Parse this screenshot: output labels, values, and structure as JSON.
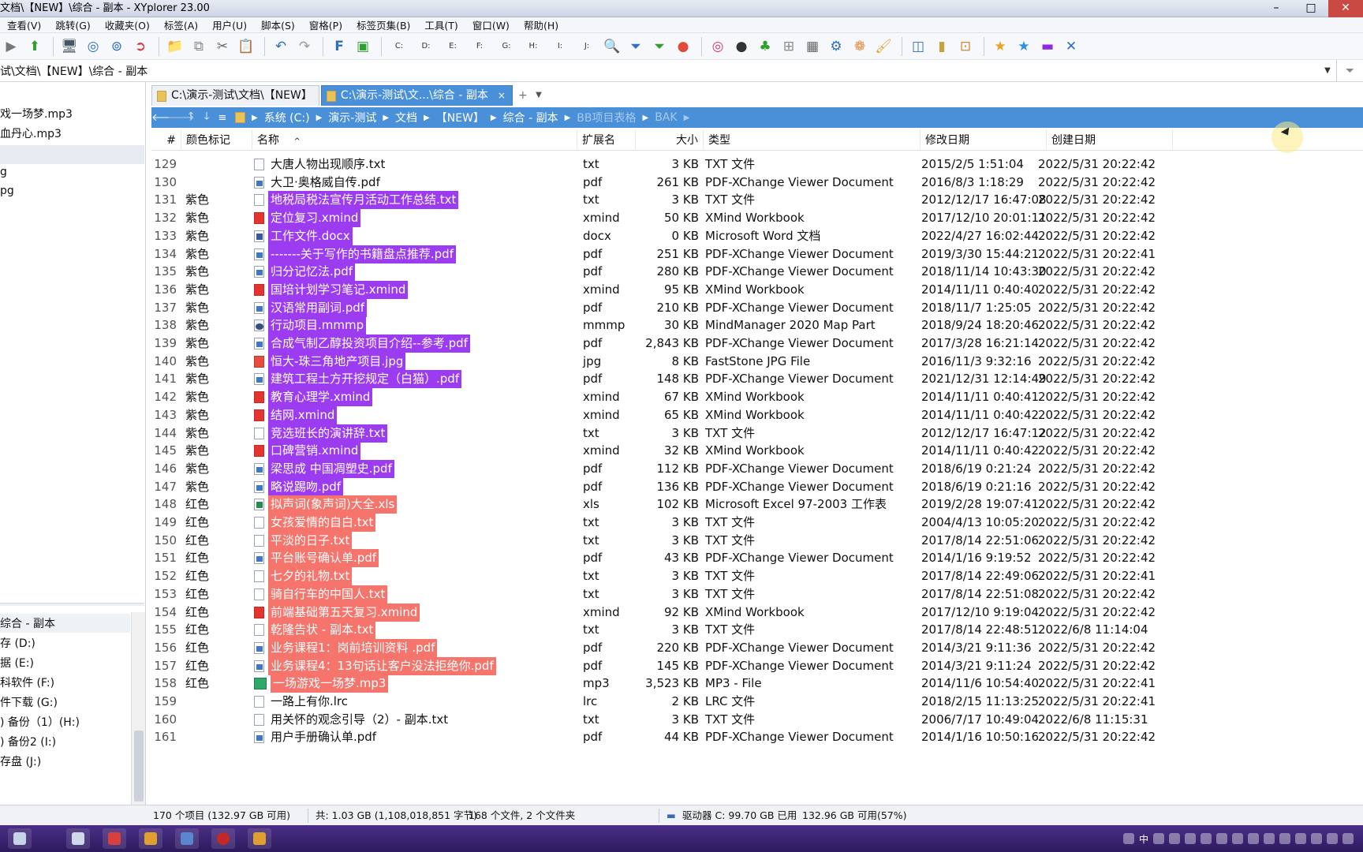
{
  "window": {
    "title": "文档\\【NEW】\\综合 - 副本 - XYplorer 23.00"
  },
  "menu": [
    "查看(V)",
    "跳转(G)",
    "收藏夹(O)",
    "标签(A)",
    "用户(U)",
    "脚本(S)",
    "窗格(P)",
    "标签页集(B)",
    "工具(T)",
    "窗口(W)",
    "帮助(H)"
  ],
  "toolbar": {
    "drives": [
      "C:",
      "D:",
      "E:",
      "F:",
      "G:",
      "H:",
      "I:",
      "J:"
    ]
  },
  "address": {
    "path": "试\\文档\\【NEW】\\综合 - 副本"
  },
  "left_pane": {
    "files": [
      "戏一场梦.mp3",
      "血丹心.mp3",
      "g",
      "pg"
    ],
    "tree_header": "综合 - 副本",
    "drives": [
      "存 (D:)",
      "据 (E:)",
      "科软件 (F:)",
      "件下载 (G:)",
      ") 备份（1）(H:)",
      ") 备份2 (I:)",
      "存盘 (J:)"
    ]
  },
  "tabs": [
    {
      "label": "C:\\演示-测试\\文档\\【NEW】",
      "active": false
    },
    {
      "label": "C:\\演示-测试\\文...\\综合 - 副本",
      "active": true
    }
  ],
  "breadcrumb": [
    "系统 (C:)",
    "演示-测试",
    "文档",
    "【NEW】",
    "综合 - 副本",
    "BB项目表格",
    "BAK"
  ],
  "columns": {
    "num": "#",
    "tag": "颜色标记",
    "name": "名称",
    "ext": "扩展名",
    "size": "大小",
    "type": "类型",
    "modified": "修改日期",
    "created": "创建日期"
  },
  "colors": {
    "purple": "#9c3cf0",
    "red": "#f5746b",
    "accent": "#4a90d9"
  },
  "rows": [
    {
      "n": "129",
      "tag": "",
      "name": "大唐人物出现顺序.txt",
      "icon": "txt",
      "ext": "txt",
      "size": "3 KB",
      "type": "TXT 文件",
      "mod": "2015/2/5 1:51:04",
      "crt": "2022/5/31 20:22:42"
    },
    {
      "n": "130",
      "tag": "",
      "name": "大卫·奥格威自传.pdf",
      "icon": "pdf",
      "ext": "pdf",
      "size": "261 KB",
      "type": "PDF-XChange Viewer Document",
      "mod": "2016/8/3 1:18:29",
      "crt": "2022/5/31 20:22:42"
    },
    {
      "n": "131",
      "tag": "紫色",
      "name": "地税局税法宣传月活动工作总结.txt",
      "icon": "txt",
      "ext": "txt",
      "size": "3 KB",
      "type": "TXT 文件",
      "mod": "2012/12/17 16:47:08",
      "crt": "2022/5/31 20:22:42"
    },
    {
      "n": "132",
      "tag": "紫色",
      "name": "定位复习.xmind",
      "icon": "xmind",
      "ext": "xmind",
      "size": "50 KB",
      "type": "XMind Workbook",
      "mod": "2017/12/10 20:01:11",
      "crt": "2022/5/31 20:22:42"
    },
    {
      "n": "133",
      "tag": "紫色",
      "name": "工作文件.docx",
      "icon": "docx",
      "ext": "docx",
      "size": "0 KB",
      "type": "Microsoft Word 文档",
      "mod": "2022/4/27 16:02:44",
      "crt": "2022/5/31 20:22:42"
    },
    {
      "n": "134",
      "tag": "紫色",
      "name": "-------关于写作的书籍盘点推荐.pdf",
      "icon": "pdf",
      "ext": "pdf",
      "size": "251 KB",
      "type": "PDF-XChange Viewer Document",
      "mod": "2019/3/30 15:44:21",
      "crt": "2022/5/31 20:22:41"
    },
    {
      "n": "135",
      "tag": "紫色",
      "name": "归分记忆法.pdf",
      "icon": "pdf",
      "ext": "pdf",
      "size": "280 KB",
      "type": "PDF-XChange Viewer Document",
      "mod": "2018/11/14 10:43:30",
      "crt": "2022/5/31 20:22:42"
    },
    {
      "n": "136",
      "tag": "紫色",
      "name": "国培计划学习笔记.xmind",
      "icon": "xmind",
      "ext": "xmind",
      "size": "95 KB",
      "type": "XMind Workbook",
      "mod": "2014/11/11 0:40:40",
      "crt": "2022/5/31 20:22:42"
    },
    {
      "n": "137",
      "tag": "紫色",
      "name": "汉语常用副词.pdf",
      "icon": "pdf",
      "ext": "pdf",
      "size": "210 KB",
      "type": "PDF-XChange Viewer Document",
      "mod": "2018/11/7 1:25:05",
      "crt": "2022/5/31 20:22:42"
    },
    {
      "n": "138",
      "tag": "紫色",
      "name": "行动项目.mmmp",
      "icon": "mmap",
      "ext": "mmmp",
      "size": "30 KB",
      "type": "MindManager 2020 Map Part",
      "mod": "2018/9/24 18:20:46",
      "crt": "2022/5/31 20:22:42"
    },
    {
      "n": "139",
      "tag": "紫色",
      "name": "合成气制乙醇投资项目介绍--参考.pdf",
      "icon": "pdf",
      "ext": "pdf",
      "size": "2,843 KB",
      "type": "PDF-XChange Viewer Document",
      "mod": "2017/3/28 16:21:14",
      "crt": "2022/5/31 20:22:42"
    },
    {
      "n": "140",
      "tag": "紫色",
      "name": "恒大-珠三角地产项目.jpg",
      "icon": "jpg",
      "ext": "jpg",
      "size": "8 KB",
      "type": "FastStone JPG File",
      "mod": "2016/11/3 9:32:16",
      "crt": "2022/5/31 20:22:42"
    },
    {
      "n": "141",
      "tag": "紫色",
      "name": "建筑工程土方开挖规定（白猫）.pdf",
      "icon": "pdf",
      "ext": "pdf",
      "size": "148 KB",
      "type": "PDF-XChange Viewer Document",
      "mod": "2021/12/31 12:14:49",
      "crt": "2022/5/31 20:22:42"
    },
    {
      "n": "142",
      "tag": "紫色",
      "name": "教育心理学.xmind",
      "icon": "xmind",
      "ext": "xmind",
      "size": "67 KB",
      "type": "XMind Workbook",
      "mod": "2014/11/11 0:40:41",
      "crt": "2022/5/31 20:22:42"
    },
    {
      "n": "143",
      "tag": "紫色",
      "name": "结网.xmind",
      "icon": "xmind",
      "ext": "xmind",
      "size": "65 KB",
      "type": "XMind Workbook",
      "mod": "2014/11/11 0:40:42",
      "crt": "2022/5/31 20:22:42"
    },
    {
      "n": "144",
      "tag": "紫色",
      "name": "竞选班长的演讲辞.txt",
      "icon": "txt",
      "ext": "txt",
      "size": "3 KB",
      "type": "TXT 文件",
      "mod": "2012/12/17 16:47:12",
      "crt": "2022/5/31 20:22:42"
    },
    {
      "n": "145",
      "tag": "紫色",
      "name": "口碑营销.xmind",
      "icon": "xmind",
      "ext": "xmind",
      "size": "32 KB",
      "type": "XMind Workbook",
      "mod": "2014/11/11 0:40:42",
      "crt": "2022/5/31 20:22:42"
    },
    {
      "n": "146",
      "tag": "紫色",
      "name": "梁思成 中国凋塑史.pdf",
      "icon": "pdf",
      "ext": "pdf",
      "size": "112 KB",
      "type": "PDF-XChange Viewer Document",
      "mod": "2018/6/19 0:21:24",
      "crt": "2022/5/31 20:22:42"
    },
    {
      "n": "147",
      "tag": "紫色",
      "name": "略说踢吻.pdf",
      "icon": "pdf",
      "ext": "pdf",
      "size": "136 KB",
      "type": "PDF-XChange Viewer Document",
      "mod": "2018/6/19 0:21:16",
      "crt": "2022/5/31 20:22:42"
    },
    {
      "n": "148",
      "tag": "红色",
      "name": "拟声词(象声词)大全.xls",
      "icon": "xls",
      "ext": "xls",
      "size": "102 KB",
      "type": "Microsoft Excel 97-2003 工作表",
      "mod": "2019/2/28 19:07:41",
      "crt": "2022/5/31 20:22:42"
    },
    {
      "n": "149",
      "tag": "红色",
      "name": "女孩爱情的自白.txt",
      "icon": "txt",
      "ext": "txt",
      "size": "3 KB",
      "type": "TXT 文件",
      "mod": "2004/4/13 10:05:20",
      "crt": "2022/5/31 20:22:42"
    },
    {
      "n": "150",
      "tag": "红色",
      "name": "平淡的日子.txt",
      "icon": "txt",
      "ext": "txt",
      "size": "3 KB",
      "type": "TXT 文件",
      "mod": "2017/8/14 22:51:06",
      "crt": "2022/5/31 20:22:42"
    },
    {
      "n": "151",
      "tag": "红色",
      "name": "平台账号确认单.pdf",
      "icon": "pdf",
      "ext": "pdf",
      "size": "43 KB",
      "type": "PDF-XChange Viewer Document",
      "mod": "2014/1/16 9:19:52",
      "crt": "2022/5/31 20:22:42"
    },
    {
      "n": "152",
      "tag": "红色",
      "name": "七夕的礼物.txt",
      "icon": "txt",
      "ext": "txt",
      "size": "3 KB",
      "type": "TXT 文件",
      "mod": "2017/8/14 22:49:06",
      "crt": "2022/5/31 20:22:41"
    },
    {
      "n": "153",
      "tag": "红色",
      "name": "骑自行车的中国人.txt",
      "icon": "txt",
      "ext": "txt",
      "size": "3 KB",
      "type": "TXT 文件",
      "mod": "2017/8/14 22:51:08",
      "crt": "2022/5/31 20:22:42"
    },
    {
      "n": "154",
      "tag": "红色",
      "name": "前端基础第五天复习.xmind",
      "icon": "xmind",
      "ext": "xmind",
      "size": "92 KB",
      "type": "XMind Workbook",
      "mod": "2017/12/10 9:19:04",
      "crt": "2022/5/31 20:22:42"
    },
    {
      "n": "155",
      "tag": "红色",
      "name": "乾隆告状 - 副本.txt",
      "icon": "txt",
      "ext": "txt",
      "size": "3 KB",
      "type": "TXT 文件",
      "mod": "2017/8/14 22:48:51",
      "crt": "2022/6/8 11:14:04"
    },
    {
      "n": "156",
      "tag": "红色",
      "name": "业务课程1：岗前培训资料 .pdf",
      "icon": "pdf",
      "ext": "pdf",
      "size": "220 KB",
      "type": "PDF-XChange Viewer Document",
      "mod": "2014/3/21 9:11:36",
      "crt": "2022/5/31 20:22:42"
    },
    {
      "n": "157",
      "tag": "红色",
      "name": "业务课程4：13句话让客户没法拒绝你.pdf",
      "icon": "pdf",
      "ext": "pdf",
      "size": "145 KB",
      "type": "PDF-XChange Viewer Document",
      "mod": "2014/3/21 9:11:24",
      "crt": "2022/5/31 20:22:42"
    },
    {
      "n": "158",
      "tag": "红色",
      "name": "一场游戏一场梦.mp3",
      "icon": "mp3",
      "ext": "mp3",
      "size": "3,523 KB",
      "type": "MP3 - File",
      "mod": "2014/11/6 10:54:40",
      "crt": "2022/5/31 20:22:41"
    },
    {
      "n": "159",
      "tag": "",
      "name": "一路上有你.lrc",
      "icon": "lrc",
      "ext": "lrc",
      "size": "2 KB",
      "type": "LRC 文件",
      "mod": "2018/2/15 11:13:25",
      "crt": "2022/5/31 20:22:41"
    },
    {
      "n": "160",
      "tag": "",
      "name": "用关怀的观念引导（2）- 副本.txt",
      "icon": "txt",
      "ext": "txt",
      "size": "3 KB",
      "type": "TXT 文件",
      "mod": "2006/7/17 10:49:04",
      "crt": "2022/6/8 11:15:31"
    },
    {
      "n": "161",
      "tag": "",
      "name": "用户手册确认单.pdf",
      "icon": "pdf",
      "ext": "pdf",
      "size": "44 KB",
      "type": "PDF-XChange Viewer Document",
      "mod": "2014/1/16 10:50:16",
      "crt": "2022/5/31 20:22:42"
    }
  ],
  "status": {
    "items": "170 个项目 (132.97 GB 可用)",
    "total": "共: 1.03 GB (1,108,018,851 字节)",
    "counts": "168 个文件, 2 个文件夹",
    "drive": "驱动器 C: 99.70 GB 已用",
    "free": "132.96 GB 可用(57%)"
  },
  "taskbar": {
    "ime": "中"
  }
}
